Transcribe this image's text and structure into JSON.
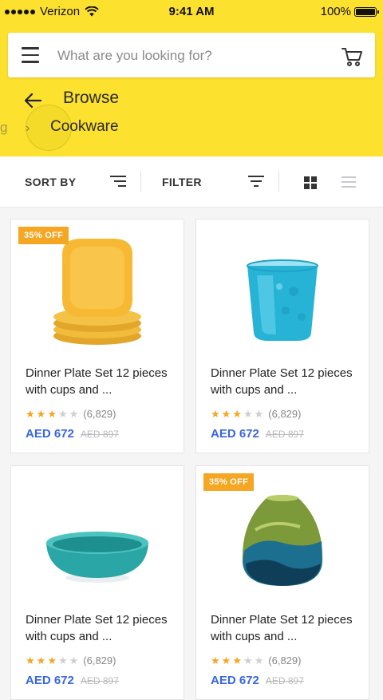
{
  "status_bar": {
    "carrier": "Verizon",
    "time": "9:41 AM",
    "battery": "100%"
  },
  "search": {
    "placeholder": "What are you looking for?"
  },
  "header": {
    "title": "Browse",
    "breadcrumb_previous": "g",
    "breadcrumb_current": "Cookware"
  },
  "toolbar": {
    "sort_label": "SORT BY",
    "filter_label": "FILTER",
    "view_mode": "grid"
  },
  "colors": {
    "header_bg": "#fde12f",
    "accent_price": "#3866df",
    "badge_bg": "#f5a623",
    "star_on": "#f5a623"
  },
  "products": [
    {
      "badge": "35% OFF",
      "title": "Dinner Plate Set 12 pieces with cups and ...",
      "rating": 3,
      "rating_max": 5,
      "reviews": "(6,829)",
      "price": "AED 672",
      "old_price": "AED 897",
      "image_icon": "yellow-plates-icon"
    },
    {
      "badge": "",
      "title": "Dinner Plate Set 12 pieces with cups and ...",
      "rating": 3,
      "rating_max": 5,
      "reviews": "(6,829)",
      "price": "AED 672",
      "old_price": "AED 897",
      "image_icon": "blue-glass-icon"
    },
    {
      "badge": "",
      "title": "Dinner Plate Set 12 pieces with cups and ...",
      "rating": 3,
      "rating_max": 5,
      "reviews": "(6,829)",
      "price": "AED 672",
      "old_price": "AED 897",
      "image_icon": "teal-bowl-icon"
    },
    {
      "badge": "35% OFF",
      "title": "Dinner Plate Set 12 pieces with cups and ...",
      "rating": 3,
      "rating_max": 5,
      "reviews": "(6,829)",
      "price": "AED 672",
      "old_price": "AED 897",
      "image_icon": "glass-vase-icon"
    }
  ]
}
